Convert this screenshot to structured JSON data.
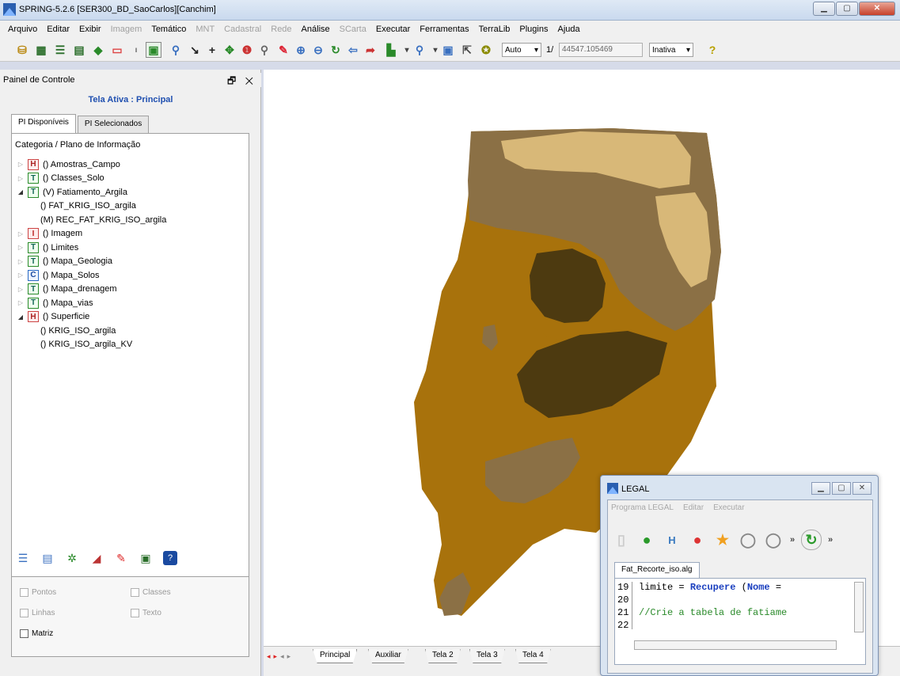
{
  "window": {
    "title": "SPRING-5.2.6 [SER300_BD_SaoCarlos][Canchim]"
  },
  "menu": [
    {
      "label": "Arquivo",
      "enabled": true
    },
    {
      "label": "Editar",
      "enabled": true
    },
    {
      "label": "Exibir",
      "enabled": true
    },
    {
      "label": "Imagem",
      "enabled": false
    },
    {
      "label": "Temático",
      "enabled": true
    },
    {
      "label": "MNT",
      "enabled": false
    },
    {
      "label": "Cadastral",
      "enabled": false
    },
    {
      "label": "Rede",
      "enabled": false
    },
    {
      "label": "Análise",
      "enabled": true
    },
    {
      "label": "SCarta",
      "enabled": false
    },
    {
      "label": "Executar",
      "enabled": true
    },
    {
      "label": "Ferramentas",
      "enabled": true
    },
    {
      "label": "TerraLib",
      "enabled": true
    },
    {
      "label": "Plugins",
      "enabled": true
    },
    {
      "label": "Ajuda",
      "enabled": true
    }
  ],
  "toolbar": {
    "auto_select": "Auto",
    "scale_prefix": "1/",
    "scale_value": "44547.105469",
    "state_select": "Inativa"
  },
  "panel": {
    "title": "Painel de Controle",
    "header_buttons": "🗗 ✕",
    "active_screen": "Tela Ativa : Principal",
    "tabs": [
      "PI Disponíveis",
      "PI Selecionados"
    ],
    "tree_header": "Categoria / Plano de Informação",
    "tree": [
      {
        "icon": "H",
        "label": "() Amostras_Campo",
        "level": 0,
        "expanded": false
      },
      {
        "icon": "T",
        "label": "() Classes_Solo",
        "level": 0,
        "expanded": false
      },
      {
        "icon": "T",
        "label": "(V) Fatiamento_Argila",
        "level": 0,
        "expanded": true
      },
      {
        "icon": "",
        "label": "() FAT_KRIG_ISO_argila",
        "level": 1
      },
      {
        "icon": "",
        "label": "(M) REC_FAT_KRIG_ISO_argila",
        "level": 1
      },
      {
        "icon": "I",
        "label": "() Imagem",
        "level": 0,
        "expanded": false
      },
      {
        "icon": "T",
        "label": "() Limites",
        "level": 0,
        "expanded": false
      },
      {
        "icon": "T",
        "label": "() Mapa_Geologia",
        "level": 0,
        "expanded": false
      },
      {
        "icon": "C",
        "label": "() Mapa_Solos",
        "level": 0,
        "expanded": false
      },
      {
        "icon": "T",
        "label": "() Mapa_drenagem",
        "level": 0,
        "expanded": false
      },
      {
        "icon": "T",
        "label": "() Mapa_vias",
        "level": 0,
        "expanded": false
      },
      {
        "icon": "H",
        "label": "() Superficie",
        "level": 0,
        "expanded": true
      },
      {
        "icon": "",
        "label": "() KRIG_ISO_argila",
        "level": 1
      },
      {
        "icon": "",
        "label": "() KRIG_ISO_argila_KV",
        "level": 1
      }
    ],
    "checks": [
      {
        "label": "Pontos",
        "checked": false,
        "enabled": false
      },
      {
        "label": "Classes",
        "checked": false,
        "enabled": false
      },
      {
        "label": "Linhas",
        "checked": false,
        "enabled": false
      },
      {
        "label": "Texto",
        "checked": false,
        "enabled": false
      },
      {
        "label": "Matriz",
        "checked": false,
        "enabled": true
      }
    ]
  },
  "bottom_tabs": [
    "Principal",
    "Auxiliar",
    "Tela 2",
    "Tela 3",
    "Tela 4"
  ],
  "map_colors": {
    "light": "#d8b878",
    "medium": "#8b7045",
    "ochre": "#a8720c",
    "dark": "#4d3a10"
  },
  "legal": {
    "title": "LEGAL",
    "menu": [
      "Programa LEGAL",
      "Editar",
      "Executar"
    ],
    "file_tab": "Fat_Recorte_iso.alg",
    "lines": [
      {
        "n": "19",
        "text": "limite = Recupere (Nome = "
      },
      {
        "n": "20",
        "text": ""
      },
      {
        "n": "21",
        "text": "//Crie a tabela de fatiame"
      },
      {
        "n": "22",
        "text": ""
      }
    ]
  }
}
